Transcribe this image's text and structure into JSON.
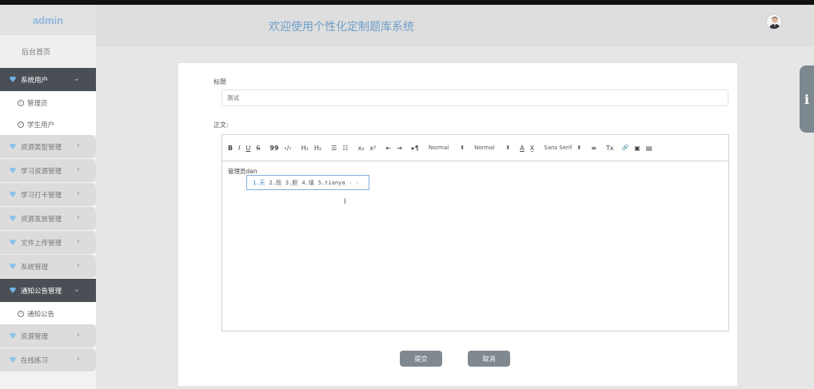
{
  "brand": "admin",
  "header": {
    "title": "欢迎使用个性化定制题库系统"
  },
  "sidebar": {
    "home": "后台首页",
    "items": [
      {
        "label": "系统用户",
        "active": true,
        "children": [
          "管理员",
          "学生用户"
        ]
      },
      {
        "label": "资源类型管理"
      },
      {
        "label": "学习资源管理"
      },
      {
        "label": "学习打卡管理"
      },
      {
        "label": "资源发放管理"
      },
      {
        "label": "文件上传管理"
      },
      {
        "label": "系统管理"
      },
      {
        "label": "通知公告管理",
        "active": true,
        "children": [
          "通知公告"
        ]
      },
      {
        "label": "资源管理"
      },
      {
        "label": "在线练习"
      }
    ]
  },
  "form": {
    "title_label": "标题",
    "title_value": "测试",
    "body_label": "正文:",
    "body_text": "管理员dan",
    "ime_candidates": [
      "1.天",
      "2.而",
      "3.胆",
      "4.填",
      "5.tianya"
    ],
    "ime_arrows": "‹ ›",
    "cursor_glyph": "I"
  },
  "toolbar": {
    "bold": "B",
    "italic": "I",
    "underline": "U",
    "strike": "S",
    "quote": "99",
    "code": "‹/›",
    "h1": "H₁",
    "h2": "H₂",
    "ol": "☰",
    "ul": "☷",
    "sub": "x₂",
    "sup": "x²",
    "outdent": "⇤",
    "indent": "⇥",
    "rtl": "▸¶",
    "size": "Normal",
    "header": "Normal",
    "color": "A",
    "bg": "X̲",
    "font": "Sans Serif",
    "align": "≡",
    "clean": "Tx",
    "link": "🔗",
    "image": "▣",
    "video": "▤",
    "dropdown_arrow": "⬍"
  },
  "buttons": {
    "submit": "提交",
    "cancel": "取消"
  },
  "side_tab": "i",
  "colors": {
    "brand": "#8fb6dc",
    "active_menu": "#4a4f55",
    "button": "#808890",
    "title": "#6f9ec9"
  }
}
